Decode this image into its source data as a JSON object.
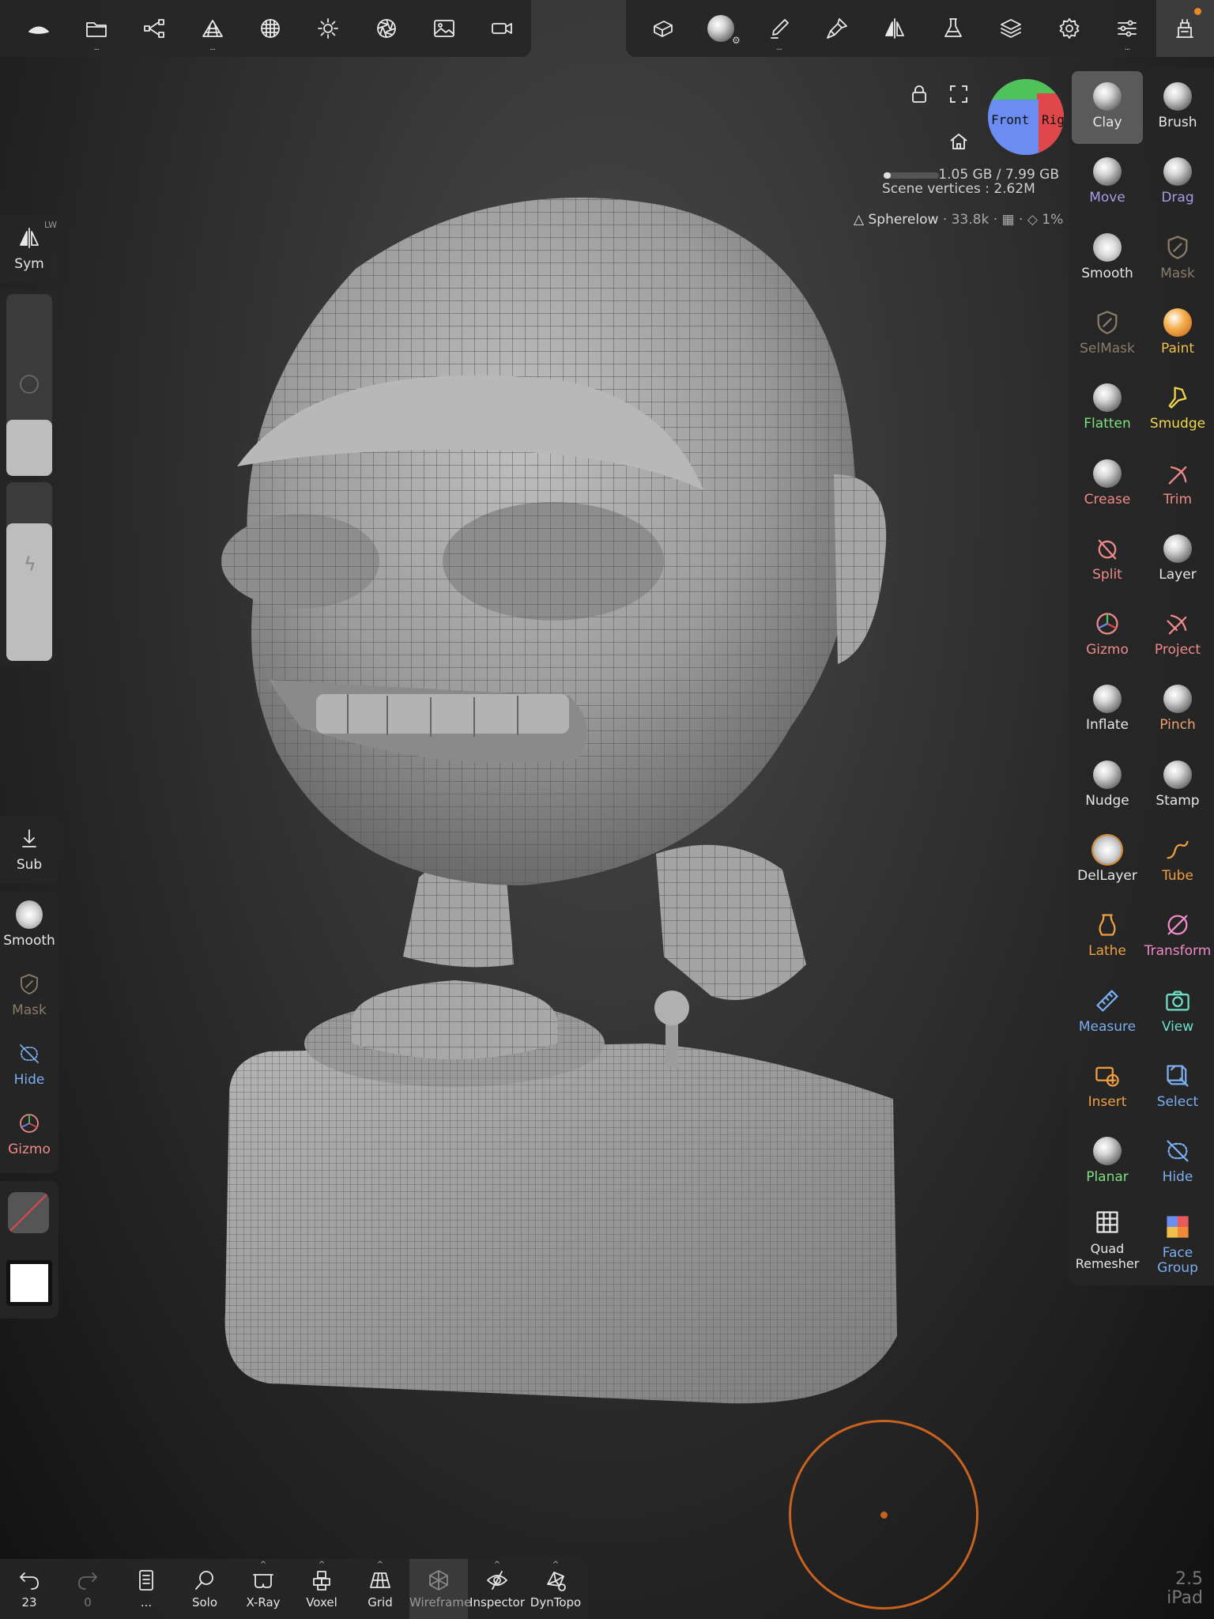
{
  "top_left_toolbar": [
    {
      "name": "app-logo-icon",
      "dots": ""
    },
    {
      "name": "files-icon",
      "dots": "..."
    },
    {
      "name": "scene-tree-icon",
      "dots": ""
    },
    {
      "name": "topology-icon",
      "dots": "..."
    },
    {
      "name": "material-icon",
      "dots": ""
    },
    {
      "name": "lighting-icon",
      "dots": ""
    },
    {
      "name": "camera-aperture-icon",
      "dots": ""
    },
    {
      "name": "background-image-icon",
      "dots": ""
    },
    {
      "name": "video-record-icon",
      "dots": ""
    }
  ],
  "top_right_toolbar": [
    {
      "name": "mesh-tools-icon",
      "dots": ""
    },
    {
      "name": "matcap-sphere-icon",
      "dots": ""
    },
    {
      "name": "brush-stroke-icon",
      "dots": "..."
    },
    {
      "name": "painting-icon",
      "dots": ""
    },
    {
      "name": "symmetry-icon",
      "dots": ""
    },
    {
      "name": "flask-icon",
      "dots": ""
    },
    {
      "name": "layers-icon",
      "dots": ""
    },
    {
      "name": "settings-gear-icon",
      "dots": ""
    },
    {
      "name": "sliders-icon",
      "dots": "..."
    },
    {
      "name": "tools-panel-icon",
      "dots": ""
    }
  ],
  "viewport": {
    "nav_cube_front": "Front",
    "nav_cube_right": "Right",
    "memory_text": "1.05 GB / 7.99 GB",
    "memory_fraction": 0.13,
    "scene_vertices": "Scene vertices : 2.62M",
    "object_name": "Spherelow",
    "object_vertices": "· 33.8k ·",
    "object_extra": "· ",
    "object_percent": "1%"
  },
  "tools": [
    {
      "label": "Clay",
      "color": "#e6e6e6",
      "selected": true
    },
    {
      "label": "Brush",
      "color": "#e6e6e6"
    },
    {
      "label": "Move",
      "color": "#a89ce8"
    },
    {
      "label": "Drag",
      "color": "#a89ce8"
    },
    {
      "label": "Smooth",
      "color": "#e6e6e6"
    },
    {
      "label": "Mask",
      "color": "#8a7c6a"
    },
    {
      "label": "SelMask",
      "color": "#8a7c6a"
    },
    {
      "label": "Paint",
      "color": "#f0c04a"
    },
    {
      "label": "Flatten",
      "color": "#7ee07e"
    },
    {
      "label": "Smudge",
      "color": "#f0d84a"
    },
    {
      "label": "Crease",
      "color": "#f08a8a"
    },
    {
      "label": "Trim",
      "color": "#f08a8a"
    },
    {
      "label": "Split",
      "color": "#f08a8a"
    },
    {
      "label": "Layer",
      "color": "#e6e6e6"
    },
    {
      "label": "Gizmo",
      "color": "#f08a8a"
    },
    {
      "label": "Project",
      "color": "#f08a8a"
    },
    {
      "label": "Inflate",
      "color": "#e6e6e6"
    },
    {
      "label": "Pinch",
      "color": "#f0a070"
    },
    {
      "label": "Nudge",
      "color": "#e6e6e6"
    },
    {
      "label": "Stamp",
      "color": "#e6e6e6"
    },
    {
      "label": "DelLayer",
      "color": "#e6e6e6"
    },
    {
      "label": "Tube",
      "color": "#f0a040"
    },
    {
      "label": "Lathe",
      "color": "#f0a040"
    },
    {
      "label": "Transform",
      "color": "#f08ac8"
    },
    {
      "label": "Measure",
      "color": "#7aaef0"
    },
    {
      "label": "View",
      "color": "#6ee0c8"
    },
    {
      "label": "Insert",
      "color": "#f0a040"
    },
    {
      "label": "Select",
      "color": "#7aaef0"
    },
    {
      "label": "Planar",
      "color": "#7ee07e"
    },
    {
      "label": "Hide",
      "color": "#7aaef0"
    },
    {
      "label": "Quad Remesher",
      "color": "#e6e6e6"
    },
    {
      "label": "Face Group",
      "color": "#7aaef0"
    }
  ],
  "left_panel": {
    "sym_label": "Sym",
    "sym_badge": "LW",
    "radius_fraction": 0.31,
    "intensity_fraction": 0.77,
    "sub_label": "Sub",
    "quick_tools": [
      {
        "label": "Smooth",
        "color": "#e6e6e6"
      },
      {
        "label": "Mask",
        "color": "#8a7c6a"
      },
      {
        "label": "Hide",
        "color": "#7aaef0"
      },
      {
        "label": "Gizmo",
        "color": "#f08a8a"
      }
    ]
  },
  "bottom_bar": [
    {
      "label": "23",
      "name": "undo-button",
      "icon": "undo-icon"
    },
    {
      "label": "0",
      "name": "redo-button",
      "icon": "redo-icon"
    },
    {
      "label": "...",
      "name": "history-button",
      "icon": "history-icon"
    },
    {
      "label": "Solo",
      "name": "solo-button",
      "icon": "search-icon"
    },
    {
      "label": "X-Ray",
      "name": "xray-button",
      "icon": "xray-glasses-icon"
    },
    {
      "label": "Voxel",
      "name": "voxel-button",
      "icon": "voxel-icon"
    },
    {
      "label": "Grid",
      "name": "grid-button",
      "icon": "grid-icon"
    },
    {
      "label": "Wireframe",
      "name": "wireframe-button",
      "icon": "wireframe-icon"
    },
    {
      "label": "Inspector",
      "name": "inspector-button",
      "icon": "inspector-eye-icon"
    },
    {
      "label": "DynTopo",
      "name": "dyntopo-button",
      "icon": "dyntopo-icon"
    }
  ],
  "version": {
    "number": "2.5",
    "device": "iPad"
  }
}
